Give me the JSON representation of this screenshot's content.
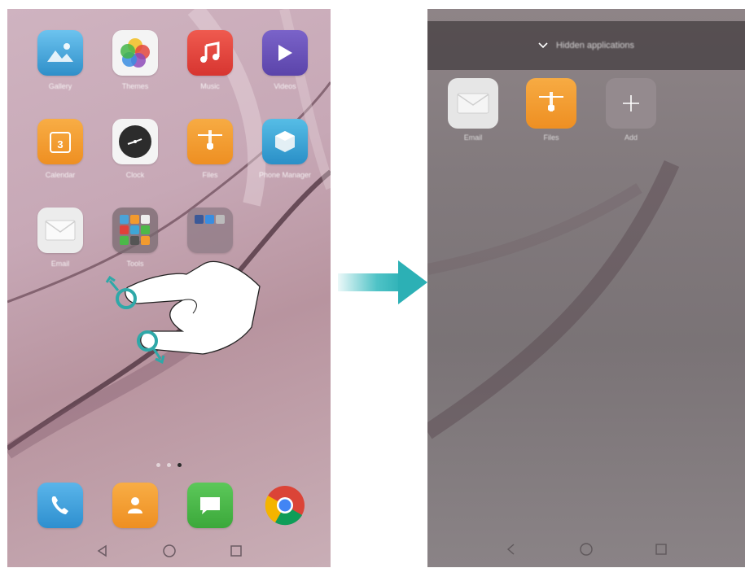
{
  "left_screen": {
    "apps_row1": [
      {
        "name": "gallery",
        "label": "Gallery",
        "icon": "mountain-photo-icon",
        "color": "#4aa3d8"
      },
      {
        "name": "themes",
        "label": "Themes",
        "icon": "color-petals-icon",
        "color": "#f2f2f2"
      },
      {
        "name": "music",
        "label": "Music",
        "icon": "music-note-icon",
        "color": "#e0403a"
      },
      {
        "name": "videos",
        "label": "Videos",
        "icon": "play-icon",
        "color": "#6a52b8"
      }
    ],
    "apps_row2": [
      {
        "name": "calendar",
        "label": "Calendar",
        "icon": "calendar-icon",
        "color": "#f29a2e"
      },
      {
        "name": "clock",
        "label": "Clock",
        "icon": "clock-icon",
        "color": "#2d2d2d"
      },
      {
        "name": "files",
        "label": "Files",
        "icon": "folder-zip-icon",
        "color": "#f29a2e"
      },
      {
        "name": "phone-manager",
        "label": "Phone Manager",
        "icon": "shield-cube-icon",
        "color": "#3fa6d6"
      }
    ],
    "apps_row3": [
      {
        "name": "email",
        "label": "Email",
        "icon": "envelope-icon",
        "color": "#ebebeb"
      },
      {
        "name": "tools",
        "label": "Tools",
        "icon": "folder-grid-icon",
        "color": "#8b7d84"
      },
      {
        "name": "social",
        "label": "",
        "icon": "folder-social-icon",
        "color": "#9f8c96"
      }
    ],
    "dock": [
      {
        "name": "phone",
        "icon": "phone-handset-icon",
        "color": "#3f9fd8"
      },
      {
        "name": "contacts",
        "icon": "contact-person-icon",
        "color": "#f29a2e"
      },
      {
        "name": "messaging",
        "icon": "chat-bubble-icon",
        "color": "#4cb849"
      },
      {
        "name": "chrome",
        "icon": "chrome-icon",
        "color": "#ffffff"
      }
    ],
    "page_dots": 3,
    "active_dot": 2
  },
  "right_screen": {
    "header_title": "Hidden applications",
    "hidden_apps": [
      {
        "name": "email",
        "label": "Email",
        "icon": "envelope-icon",
        "color": "#e8e8e8"
      },
      {
        "name": "files",
        "label": "Files",
        "icon": "folder-zip-icon",
        "color": "#f29a2e"
      },
      {
        "name": "add",
        "label": "Add",
        "icon": "plus-icon",
        "color": "#8f8689"
      }
    ]
  },
  "colors": {
    "arrow": "#3bbcc0",
    "gesture_touch": "#2fa8a8"
  }
}
